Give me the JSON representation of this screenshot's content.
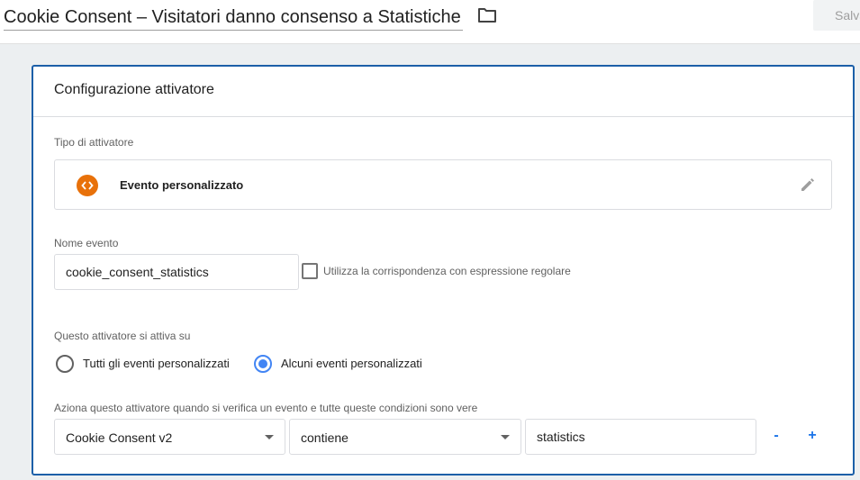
{
  "header": {
    "title": "Cookie Consent – Visitatori danno consenso a Statistiche",
    "save_label": "Salva"
  },
  "card": {
    "title": "Configurazione attivatore",
    "trigger_type": {
      "label": "Tipo di attivatore",
      "value": "Evento personalizzato",
      "icon": "custom-event-icon",
      "icon_color": "#e8710a"
    },
    "event_name": {
      "label": "Nome evento",
      "value": "cookie_consent_statistics",
      "regex_label": "Utilizza la corrispondenza con espressione regolare",
      "regex_checked": false
    },
    "fires_on": {
      "label": "Questo attivatore si attiva su",
      "options": [
        {
          "label": "Tutti gli eventi personalizzati",
          "selected": false
        },
        {
          "label": "Alcuni eventi personalizzati",
          "selected": true
        }
      ]
    },
    "conditions": {
      "label": "Aziona questo attivatore quando si verifica un evento e tutte queste condizioni sono vere",
      "rows": [
        {
          "variable": "Cookie Consent v2",
          "operator": "contiene",
          "value": "statistics"
        }
      ],
      "remove_label": "-",
      "add_label": "+"
    }
  },
  "colors": {
    "accent": "#1a73e8",
    "card_border": "#1c5fa8",
    "radio_selected": "#4285f4"
  }
}
